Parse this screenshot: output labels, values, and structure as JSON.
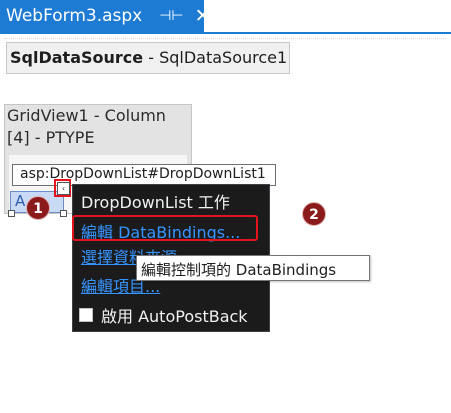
{
  "tab": {
    "title": "WebForm3.aspx",
    "pin_glyph": "⊣⊢",
    "close_glyph": "✕"
  },
  "sqldatasource": {
    "type": "SqlDataSource",
    "separator": " - ",
    "name": "SqlDataSource1"
  },
  "gridview": {
    "header_line1": "GridView1 - Column",
    "header_line2": "[4] - PTYPE"
  },
  "control_tag": "asp:DropDownList#DropDownList1",
  "ddl_preview": {
    "text": "A",
    "arrow": "▼"
  },
  "smart_tag_glyph": "‹",
  "panel": {
    "title": "DropDownList 工作",
    "links": [
      "編輯 DataBindings...",
      "選擇資料來源...",
      "編輯項目..."
    ],
    "checkbox_label": "啟用 AutoPostBack"
  },
  "tooltip": "編輯控制項的 DataBindings",
  "badges": [
    "1",
    "2"
  ],
  "colors": {
    "tab_accent": "#1e7bd3",
    "highlight": "#e5131c",
    "badge": "#8b1a1a",
    "panel_bg": "#1b1b1c",
    "link": "#3794ff"
  },
  "icons": [
    "pin-icon",
    "close-icon",
    "dropdown-arrow-icon",
    "smart-tag-icon"
  ]
}
